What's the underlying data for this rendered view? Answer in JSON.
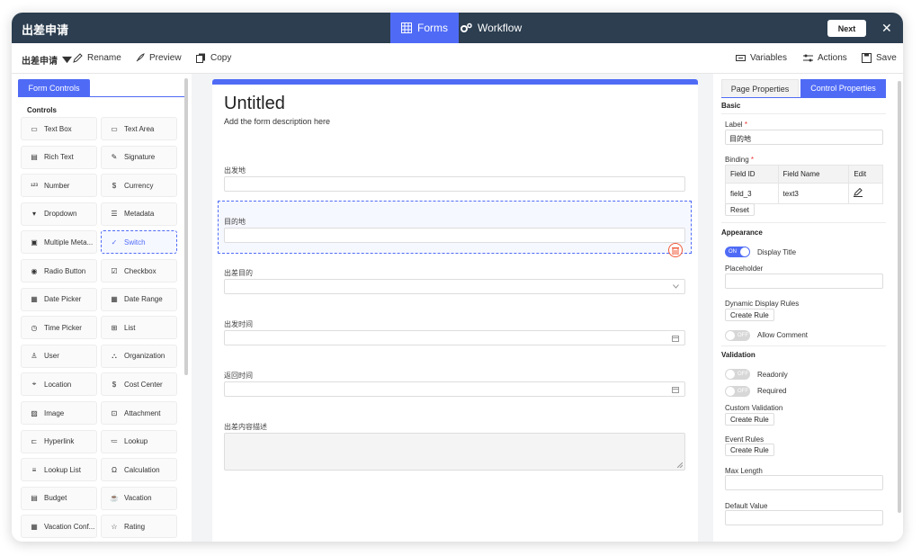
{
  "app": {
    "title": "出差申请"
  },
  "nav": {
    "tabs": [
      {
        "label": "Forms",
        "icon": "grid-icon",
        "active": true
      },
      {
        "label": "Workflow",
        "icon": "gears-icon",
        "active": false
      }
    ],
    "next_label": "Next",
    "close_glyph": "✕"
  },
  "toolbar": {
    "form_name": "出差申请",
    "rename": "Rename",
    "preview": "Preview",
    "copy": "Copy",
    "variables": "Variables",
    "actions": "Actions",
    "save": "Save"
  },
  "left_panel": {
    "tab": "Form Controls",
    "heading": "Controls",
    "controls": [
      {
        "label": "Text Box",
        "icon": "textbox-icon"
      },
      {
        "label": "Text Area",
        "icon": "textarea-icon"
      },
      {
        "label": "Rich Text",
        "icon": "richtext-icon"
      },
      {
        "label": "Signature",
        "icon": "pen-icon"
      },
      {
        "label": "Number",
        "icon": "number-icon"
      },
      {
        "label": "Currency",
        "icon": "currency-icon"
      },
      {
        "label": "Dropdown",
        "icon": "dropdown-icon"
      },
      {
        "label": "Metadata",
        "icon": "metadata-icon"
      },
      {
        "label": "Multiple Meta...",
        "icon": "multi-metadata-icon"
      },
      {
        "label": "Switch",
        "icon": "switch-icon",
        "selected": true
      },
      {
        "label": "Radio Button",
        "icon": "radio-icon"
      },
      {
        "label": "Checkbox",
        "icon": "checkbox-icon"
      },
      {
        "label": "Date Picker",
        "icon": "calendar-icon"
      },
      {
        "label": "Date Range",
        "icon": "date-range-icon"
      },
      {
        "label": "Time Picker",
        "icon": "clock-icon"
      },
      {
        "label": "List",
        "icon": "table-icon"
      },
      {
        "label": "User",
        "icon": "user-icon"
      },
      {
        "label": "Organization",
        "icon": "org-icon"
      },
      {
        "label": "Location",
        "icon": "pin-icon"
      },
      {
        "label": "Cost Center",
        "icon": "cost-center-icon"
      },
      {
        "label": "Image",
        "icon": "image-icon"
      },
      {
        "label": "Attachment",
        "icon": "attachment-icon"
      },
      {
        "label": "Hyperlink",
        "icon": "hyperlink-icon"
      },
      {
        "label": "Lookup",
        "icon": "lookup-icon"
      },
      {
        "label": "Lookup List",
        "icon": "lookup-list-icon"
      },
      {
        "label": "Calculation",
        "icon": "omega-icon"
      },
      {
        "label": "Budget",
        "icon": "budget-icon"
      },
      {
        "label": "Vacation",
        "icon": "vacation-icon"
      },
      {
        "label": "Vacation Conf...",
        "icon": "vacation-conf-icon"
      },
      {
        "label": "Rating",
        "icon": "star-icon"
      }
    ]
  },
  "form": {
    "title": "Untitled",
    "description": "Add the form description here",
    "fields": [
      {
        "label": "出发地",
        "type": "text"
      },
      {
        "label": "目的地",
        "type": "text",
        "selected": true
      },
      {
        "label": "出差目的",
        "type": "dropdown"
      },
      {
        "label": "出发时间",
        "type": "date"
      },
      {
        "label": "返回时间",
        "type": "date"
      },
      {
        "label": "出差内容描述",
        "type": "textarea"
      }
    ]
  },
  "right_panel": {
    "tabs": [
      "Page Properties",
      "Control Properties"
    ],
    "basic": "Basic",
    "label_label": "Label",
    "label_value": "目的地",
    "binding_label": "Binding",
    "binding_headers": [
      "Field ID",
      "Field Name",
      "Edit"
    ],
    "binding_row": [
      "field_3",
      "text3"
    ],
    "reset": "Reset",
    "appearance": "Appearance",
    "display_title": "Display Title",
    "display_title_state": "ON",
    "placeholder": "Placeholder",
    "dynamic_rules": "Dynamic Display Rules",
    "create_rule": "Create Rule",
    "allow_comment": "Allow Comment",
    "allow_comment_state": "OFF",
    "validation": "Validation",
    "readonly": "Readonly",
    "readonly_state": "OFF",
    "required": "Required",
    "required_state": "OFF",
    "custom_validation": "Custom Validation",
    "event_rules": "Event Rules",
    "max_length": "Max Length",
    "default_value": "Default Value",
    "required_mark": "*"
  },
  "colors": {
    "topbar": "#2c3e50",
    "accent": "#4f6bf6",
    "delete": "#f05a3a"
  }
}
